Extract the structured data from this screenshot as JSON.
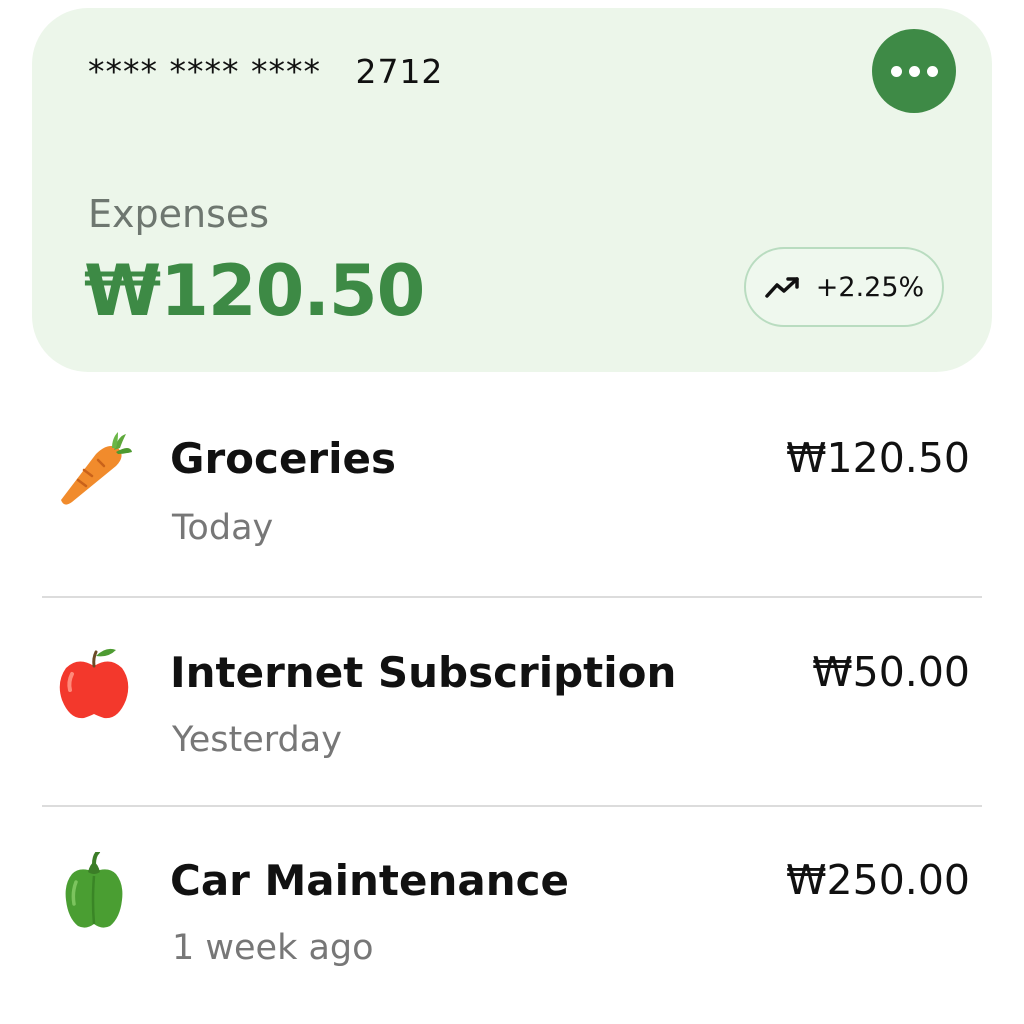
{
  "card": {
    "number_masked": "**** **** ****   2712",
    "menu_icon": "more-horizontal-icon",
    "expenses_label": "Expenses",
    "expenses_amount": "₩120.50",
    "trend_icon": "trending-up-icon",
    "trend_value": "+2.25%",
    "accent_color": "#3d8a45",
    "background_color": "#ecf6ea"
  },
  "transactions": [
    {
      "icon": "carrot-icon",
      "name": "Groceries",
      "date": "Today",
      "amount": "₩120.50"
    },
    {
      "icon": "apple-icon",
      "name": "Internet Subscription",
      "date": "Yesterday",
      "amount": "₩50.00"
    },
    {
      "icon": "bell-pepper-icon",
      "name": "Car Maintenance",
      "date": "1 week ago",
      "amount": "₩250.00"
    }
  ]
}
